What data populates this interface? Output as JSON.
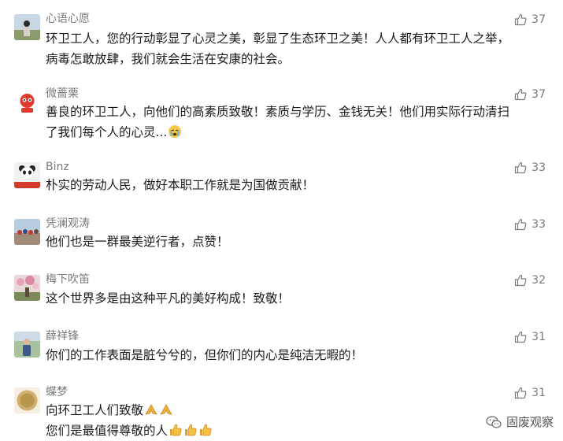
{
  "comments": [
    {
      "name": "心语心愿",
      "lines": [
        "环卫工人，您的行动彰显了心灵之美，彰显了生态环卫之美！人人都有环卫工人之举，",
        "病毒怎敢放肆，我们就会生活在安康的社会。"
      ],
      "likes": "37",
      "avatar_icon": "person-photo-avatar"
    },
    {
      "name": "微蔷栗",
      "lines": [
        "善良的环卫工人，向他们的高素质致敬！素质与学历、金钱无关！他们用实际行动清扫",
        "了我们每个人的心灵..."
      ],
      "likes": "37",
      "avatar_icon": "red-mascot-avatar",
      "trailing_emoji": "crying-face-emoji"
    },
    {
      "name": "Binz",
      "lines": [
        "朴实的劳动人民，做好本职工作就是为国做贡献！"
      ],
      "likes": "33",
      "avatar_icon": "panda-avatar"
    },
    {
      "name": "凭澜观涛",
      "lines": [
        "他们也是一群最美逆行者，点赞！"
      ],
      "likes": "33",
      "avatar_icon": "crowd-photo-avatar"
    },
    {
      "name": "梅下吹笛",
      "lines": [
        "这个世界多是由这种平凡的美好构成！致敬！"
      ],
      "likes": "32",
      "avatar_icon": "blossom-photo-avatar"
    },
    {
      "name": "薛祥锋",
      "lines": [
        "你们的工作表面是脏兮兮的，但你们的内心是纯洁无暇的！"
      ],
      "likes": "31",
      "avatar_icon": "person-outdoor-avatar"
    },
    {
      "name": "蝶梦",
      "lines": [
        "向环卫工人们致敬",
        "您们是最值得尊敬的人"
      ],
      "likes": "31",
      "avatar_icon": "gold-circle-avatar",
      "line_emojis": [
        [
          "praying-hands-emoji",
          "praying-hands-emoji"
        ],
        [
          "thumbs-up-emoji",
          "thumbs-up-emoji",
          "thumbs-up-emoji"
        ]
      ]
    }
  ],
  "watermark": {
    "label": "固废观察",
    "icon": "wechat-icon"
  },
  "colors": {
    "text": "#1a1a1a",
    "muted": "#7a7a7a",
    "background": "#ffffff"
  }
}
